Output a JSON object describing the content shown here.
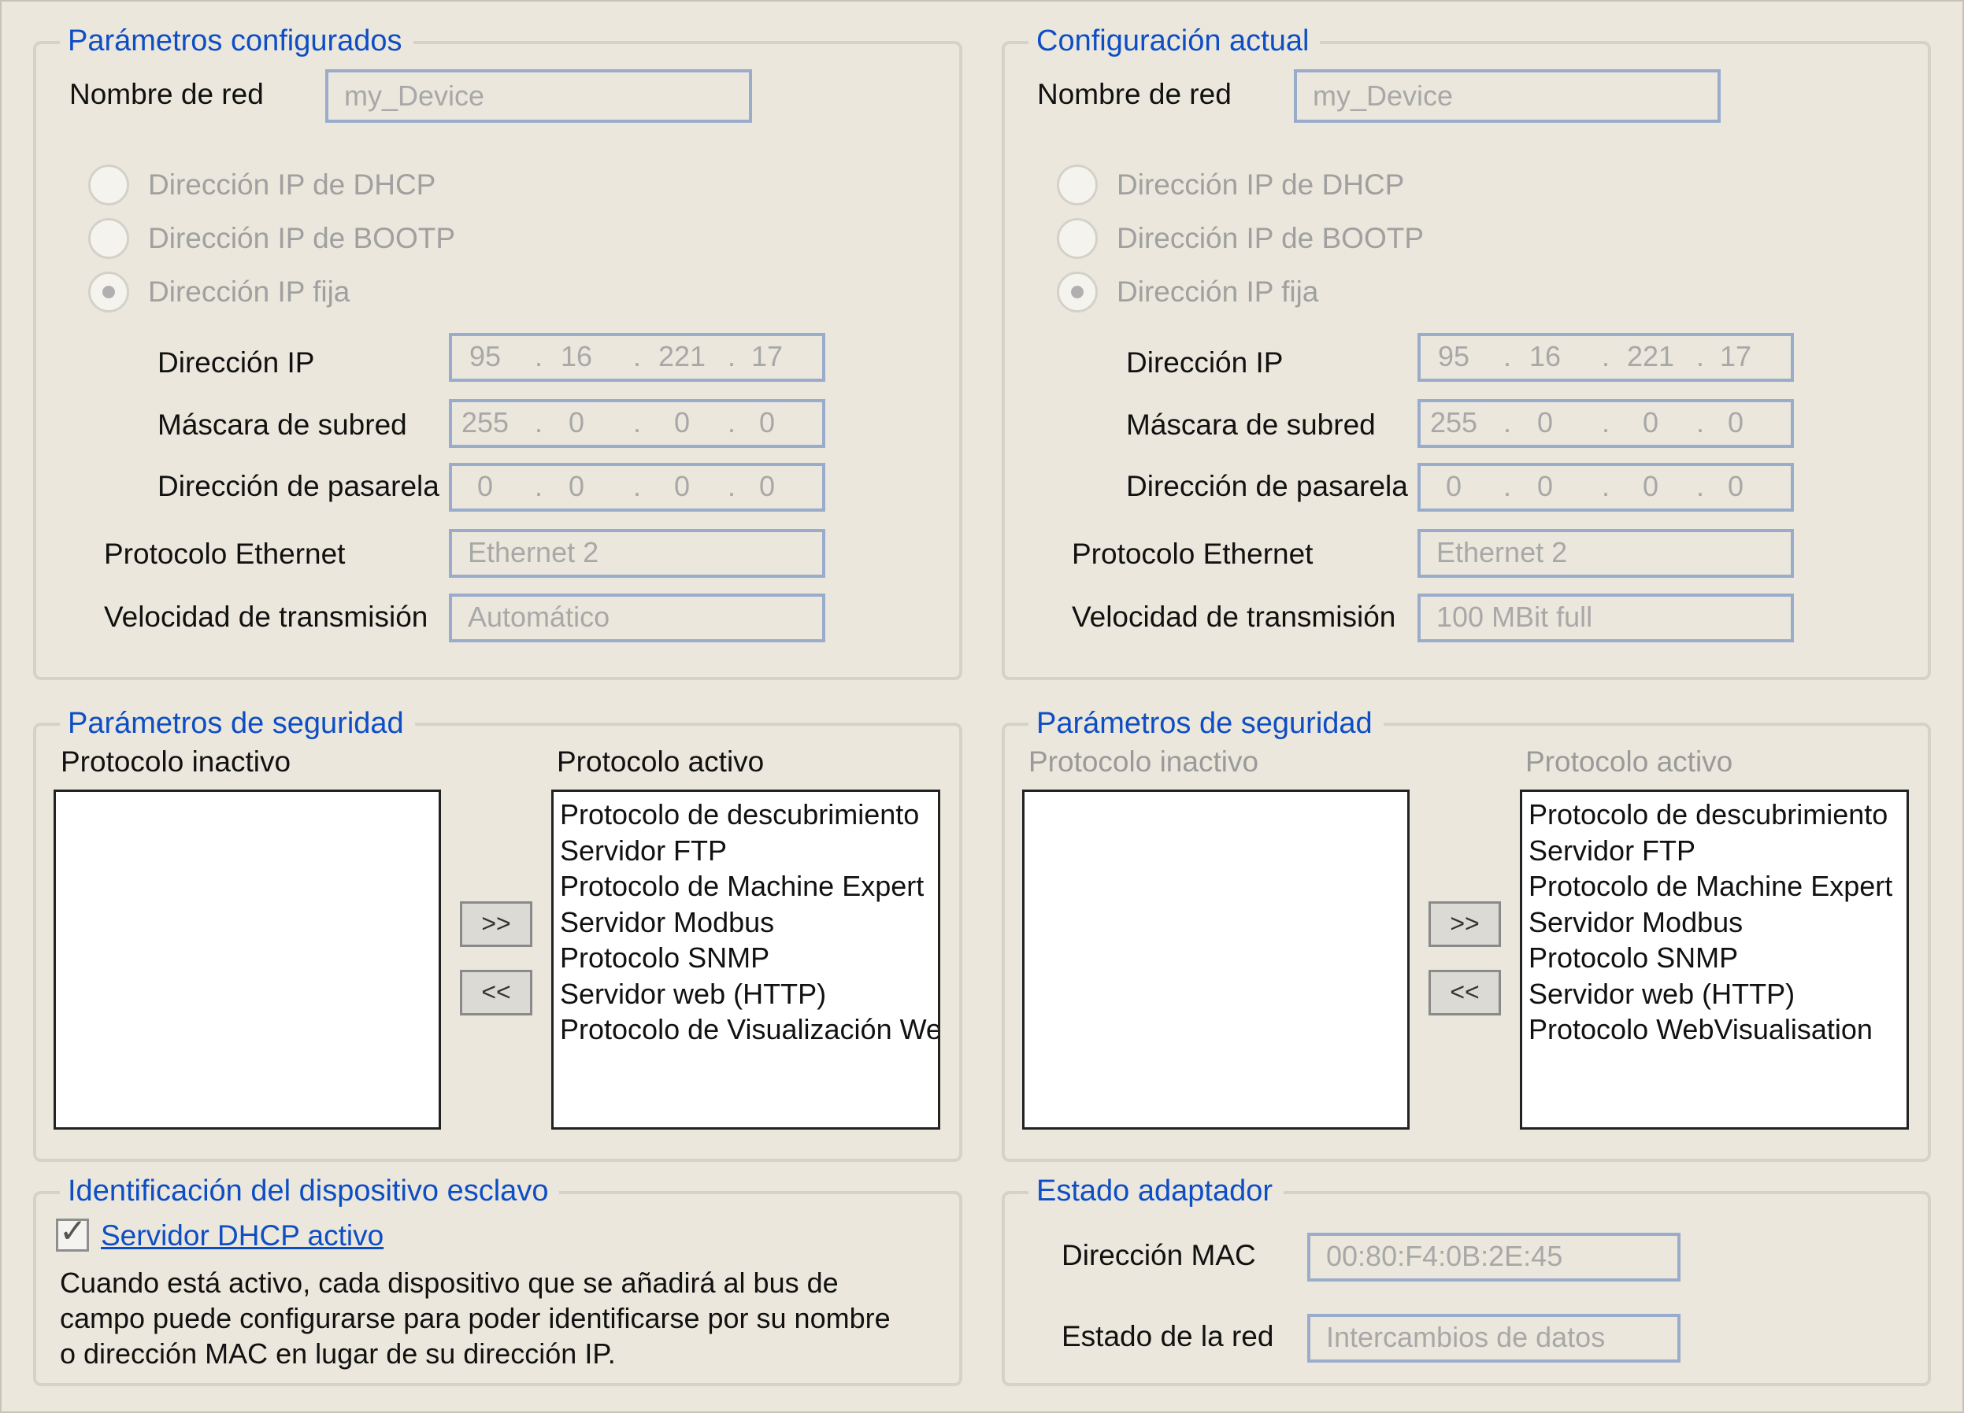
{
  "left": {
    "config_title": "Parámetros configurados",
    "network_name_label": "Nombre de red",
    "network_name_value": "my_Device",
    "radio_dhcp": "Dirección IP de DHCP",
    "radio_bootp": "Dirección IP de BOOTP",
    "radio_fixed": "Dirección IP fija",
    "ip_label": "Dirección IP",
    "ip": [
      "95",
      "16",
      "221",
      "17"
    ],
    "mask_label": "Máscara de subred",
    "mask": [
      "255",
      "0",
      "0",
      "0"
    ],
    "gateway_label": "Dirección de pasarela",
    "gateway": [
      "0",
      "0",
      "0",
      "0"
    ],
    "protocol_label": "Protocolo Ethernet",
    "protocol_value": "Ethernet 2",
    "speed_label": "Velocidad de transmisión",
    "speed_value": "Automático",
    "security_title": "Parámetros de seguridad",
    "inactive_label": "Protocolo inactivo",
    "active_label": "Protocolo activo",
    "active_items": [
      "Protocolo de descubrimiento",
      "Servidor FTP",
      "Protocolo de Machine Expert",
      "Servidor Modbus",
      "Protocolo SNMP",
      "Servidor web (HTTP)",
      "Protocolo de Visualización Web"
    ],
    "btn_add": ">>",
    "btn_remove": "<<",
    "slave_title": "Identificación del dispositivo esclavo",
    "dhcp_server_label": "Servidor DHCP activo",
    "dhcp_server_checked": true,
    "description": [
      "Cuando está activo, cada dispositivo que se añadirá al bus de",
      "campo puede configurarse para poder identificarse por su nombre",
      "o dirección MAC en lugar de su dirección IP."
    ]
  },
  "right": {
    "config_title": "Configuración actual",
    "network_name_label": "Nombre de red",
    "network_name_value": "my_Device",
    "radio_dhcp": "Dirección IP de DHCP",
    "radio_bootp": "Dirección IP de BOOTP",
    "radio_fixed": "Dirección IP fija",
    "ip_label": "Dirección IP",
    "ip": [
      "95",
      "16",
      "221",
      "17"
    ],
    "mask_label": "Máscara de subred",
    "mask": [
      "255",
      "0",
      "0",
      "0"
    ],
    "gateway_label": "Dirección de pasarela",
    "gateway": [
      "0",
      "0",
      "0",
      "0"
    ],
    "protocol_label": "Protocolo Ethernet",
    "protocol_value": "Ethernet 2",
    "speed_label": "Velocidad de transmisión",
    "speed_value": "100 MBit full",
    "security_title": "Parámetros de seguridad",
    "inactive_label": "Protocolo inactivo",
    "active_label": "Protocolo activo",
    "active_items": [
      "Protocolo de descubrimiento",
      "Servidor FTP",
      "Protocolo de Machine Expert",
      "Servidor Modbus",
      "Protocolo SNMP",
      "Servidor web (HTTP)",
      "Protocolo WebVisualisation"
    ],
    "btn_add": ">>",
    "btn_remove": "<<",
    "adapter_title": "Estado adaptador",
    "mac_label": "Dirección MAC",
    "mac_value": "00:80:F4:0B:2E:45",
    "net_state_label": "Estado de la red",
    "net_state_value": "Intercambios de datos"
  },
  "colors": {
    "background": "#ebe7dc",
    "legend": "#0e4ec5",
    "field_border": "#9aaccb",
    "disabled_text": "#a8a8a8"
  }
}
